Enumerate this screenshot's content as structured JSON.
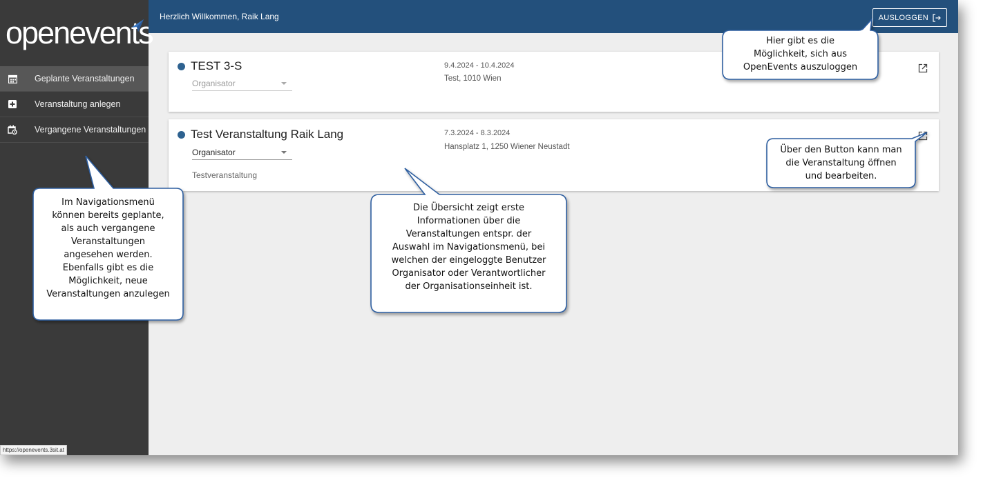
{
  "app": {
    "logo_text": "openevents",
    "status_url": "https://openevents.3sit.at"
  },
  "sidebar": {
    "items": [
      {
        "label": "Geplante Veranstaltungen",
        "icon": "calendar-icon",
        "active": true
      },
      {
        "label": "Veranstaltung anlegen",
        "icon": "plus-box-icon",
        "active": false
      },
      {
        "label": "Vergangene Veranstaltungen",
        "icon": "calendar-history-icon",
        "active": false
      }
    ]
  },
  "header": {
    "welcome": "Herzlich Willkommen, Raik Lang",
    "logout_label": "AUSLOGGEN",
    "logout_icon": "logout-icon",
    "color": "#23507c"
  },
  "events": [
    {
      "title": "TEST 3-S",
      "role": "Organisator",
      "role_muted": true,
      "date": "9.4.2024 - 10.4.2024",
      "location": "Test, 1010 Wien",
      "description": "",
      "open_icon": "open-external-icon"
    },
    {
      "title": "Test Veranstaltung Raik Lang",
      "role": "Organisator",
      "role_muted": false,
      "date": "7.3.2024 - 8.3.2024",
      "location": "Hansplatz 1, 1250 Wiener Neustadt",
      "description": "Testveranstaltung",
      "open_icon": "open-external-icon"
    }
  ],
  "callouts": {
    "logout": "Hier gibt es die\nMöglichkeit, sich aus\nOpenEvents auszuloggen",
    "nav": "Im Navigationsmenü\nkönnen bereits geplante,\nals auch vergangene\nVeranstaltungen\nangesehen werden.\nEbenfalls gibt es die\nMöglichkeit, neue\nVeranstaltungen anzulegen",
    "overview": "Die Übersicht zeigt erste\nInformationen über die\nVeranstaltungen entspr. der\nAuswahl im Navigationsmenü, bei\nwelchen der eingeloggte Benutzer\nOrganisator oder Verantwortlicher\nder Organisationseinheit ist.",
    "open_button": "Über den Button kann man\ndie Veranstaltung öffnen\nund bearbeiten."
  },
  "colors": {
    "sidebar": "#3a3a3a",
    "accent_dot": "#2e6290",
    "callout_border": "#2f5ea0"
  }
}
